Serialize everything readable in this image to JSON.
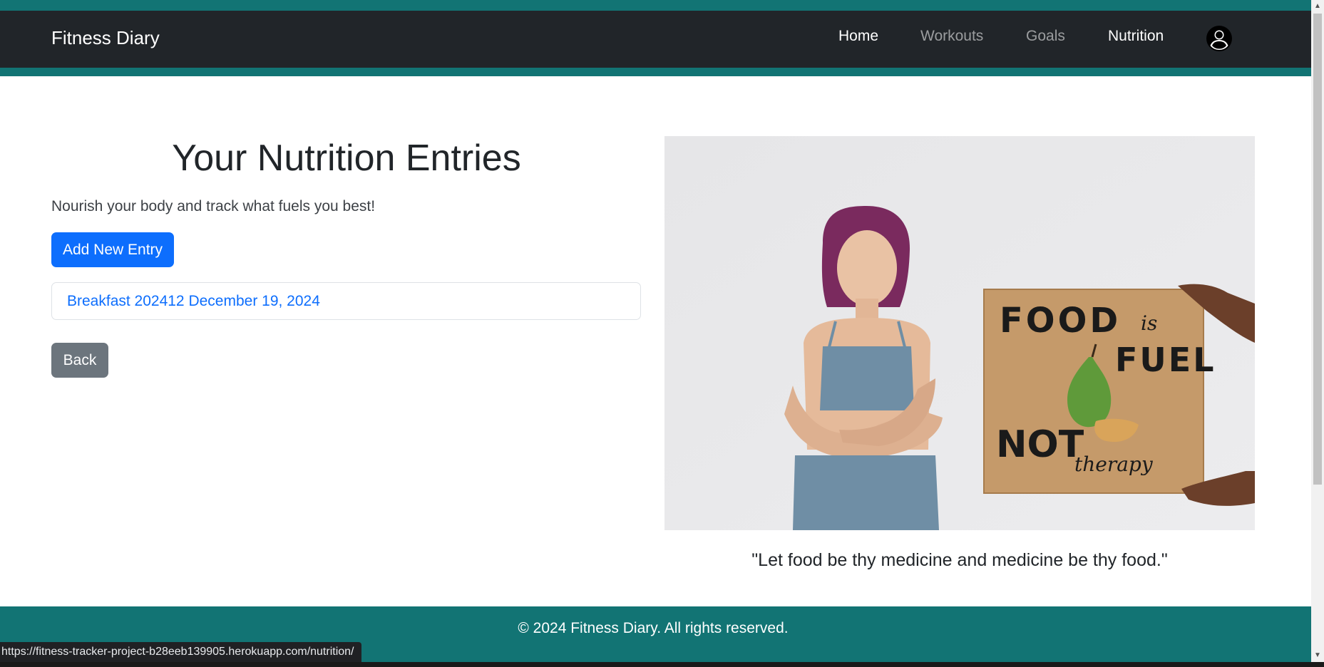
{
  "navbar": {
    "brand": "Fitness Diary",
    "links": {
      "home": "Home",
      "workouts": "Workouts",
      "goals": "Goals",
      "nutrition": "Nutrition"
    },
    "avatar_icon": "user-circle-icon"
  },
  "main": {
    "title": "Your Nutrition Entries",
    "subtitle": "Nourish your body and track what fuels you best!",
    "add_button": "Add New Entry",
    "entries": [
      {
        "label": "Breakfast 202412 December 19, 2024"
      }
    ],
    "back_button": "Back"
  },
  "hero": {
    "sign_lines": {
      "food": "FOOD",
      "is": "is",
      "fuel": "FUEL",
      "not": "NOT",
      "therapy": "therapy"
    },
    "quote": "\"Let food be thy medicine and medicine be thy food.\""
  },
  "footer": {
    "text": "© 2024 Fitness Diary. All rights reserved."
  },
  "status_bar": {
    "url": "https://fitness-tracker-project-b28eeb139905.herokuapp.com/nutrition/"
  },
  "colors": {
    "accent_teal": "#127474",
    "navbar_dark": "#212529",
    "primary": "#0d6efd",
    "secondary": "#6c757d"
  }
}
